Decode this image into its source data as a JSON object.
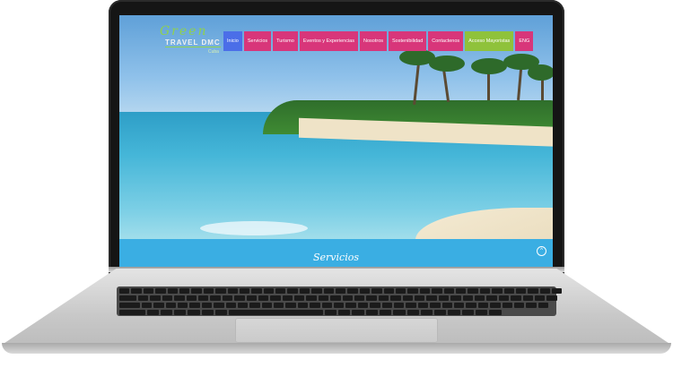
{
  "logo": {
    "line1": "Green",
    "line2": "TRAVEL DMC",
    "line3": "Cuba"
  },
  "nav": [
    {
      "label": "Inicio",
      "color": "#4b6ee8"
    },
    {
      "label": "Servicios",
      "color": "#d8367a"
    },
    {
      "label": "Turismo",
      "color": "#d8367a"
    },
    {
      "label": "Eventos y Experiencias",
      "color": "#d8367a"
    },
    {
      "label": "Nosotros",
      "color": "#d8367a"
    },
    {
      "label": "Sostenibilidad",
      "color": "#d8367a"
    },
    {
      "label": "Contactenos",
      "color": "#d8367a"
    },
    {
      "label": "Acceso Mayoristas",
      "color": "#8fc23b"
    },
    {
      "label": "ENG",
      "color": "#d8367a"
    }
  ],
  "services": {
    "title": "Servicios",
    "band_color": "#3aaee3"
  },
  "up_button": {
    "icon": "chevron-up-icon",
    "glyph": "^"
  }
}
